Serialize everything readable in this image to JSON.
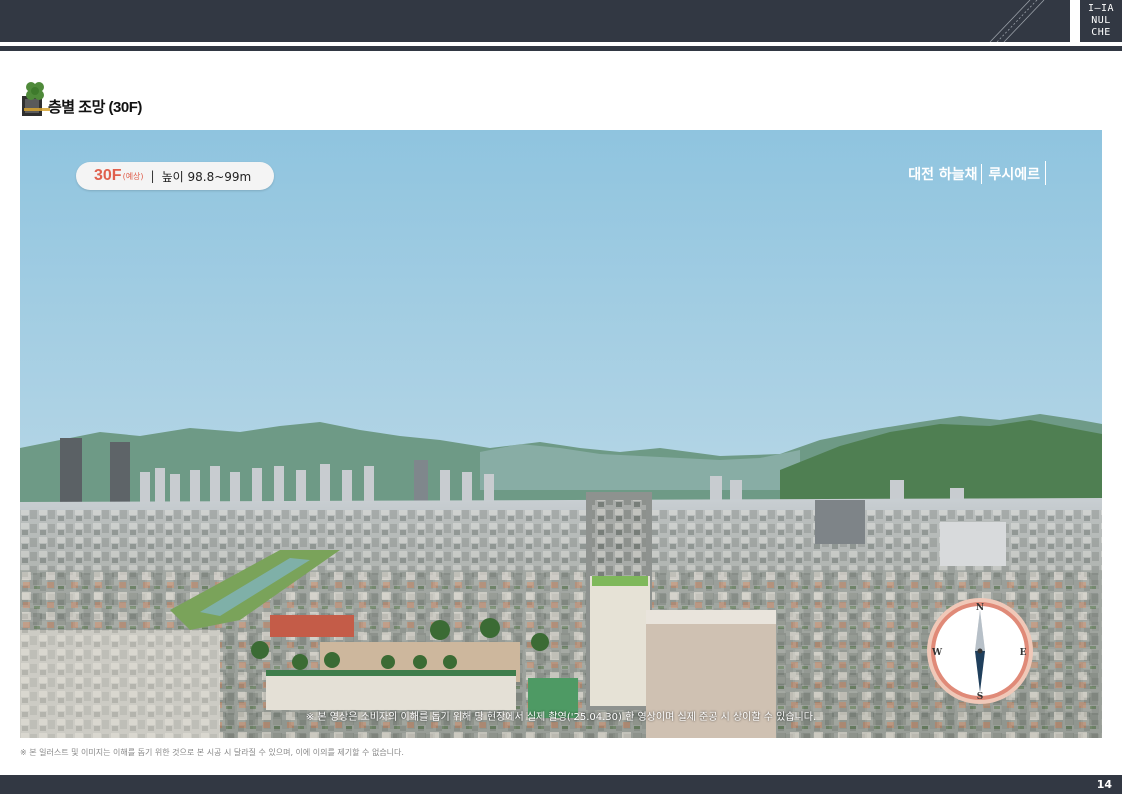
{
  "header": {
    "logo_text": "I–IA\nNUL\nCHE"
  },
  "section": {
    "title": "층별 조망 (30F)"
  },
  "overlay": {
    "floor_label": "30F",
    "floor_note": "(예상)",
    "separator": "|",
    "height_text": "높이 98.8~99m",
    "brand_name": "대전 하늘채",
    "brand_sub": "루시에르",
    "compass": {
      "n": "N",
      "e": "E",
      "s": "S",
      "w": "W"
    },
    "video_note": "※ 본 영상은 소비자의 이해를 돕기 위해 당 현장에서 실제 촬영('25.04.30) 한 영상이며 실제 준공 시 상이할 수 있습니다."
  },
  "footnote": "※ 본 일러스트 및 이미지는 이해를 돕기 위한 것으로 본 시공 시 달라질 수 있으며, 이에 이의를 제기할 수 없습니다.",
  "footer": {
    "page_number": "14"
  },
  "colors": {
    "bar": "#323843",
    "accent": "#e0604d",
    "sky_top": "#8fc4df",
    "sky_bottom": "#d5e6ee"
  }
}
